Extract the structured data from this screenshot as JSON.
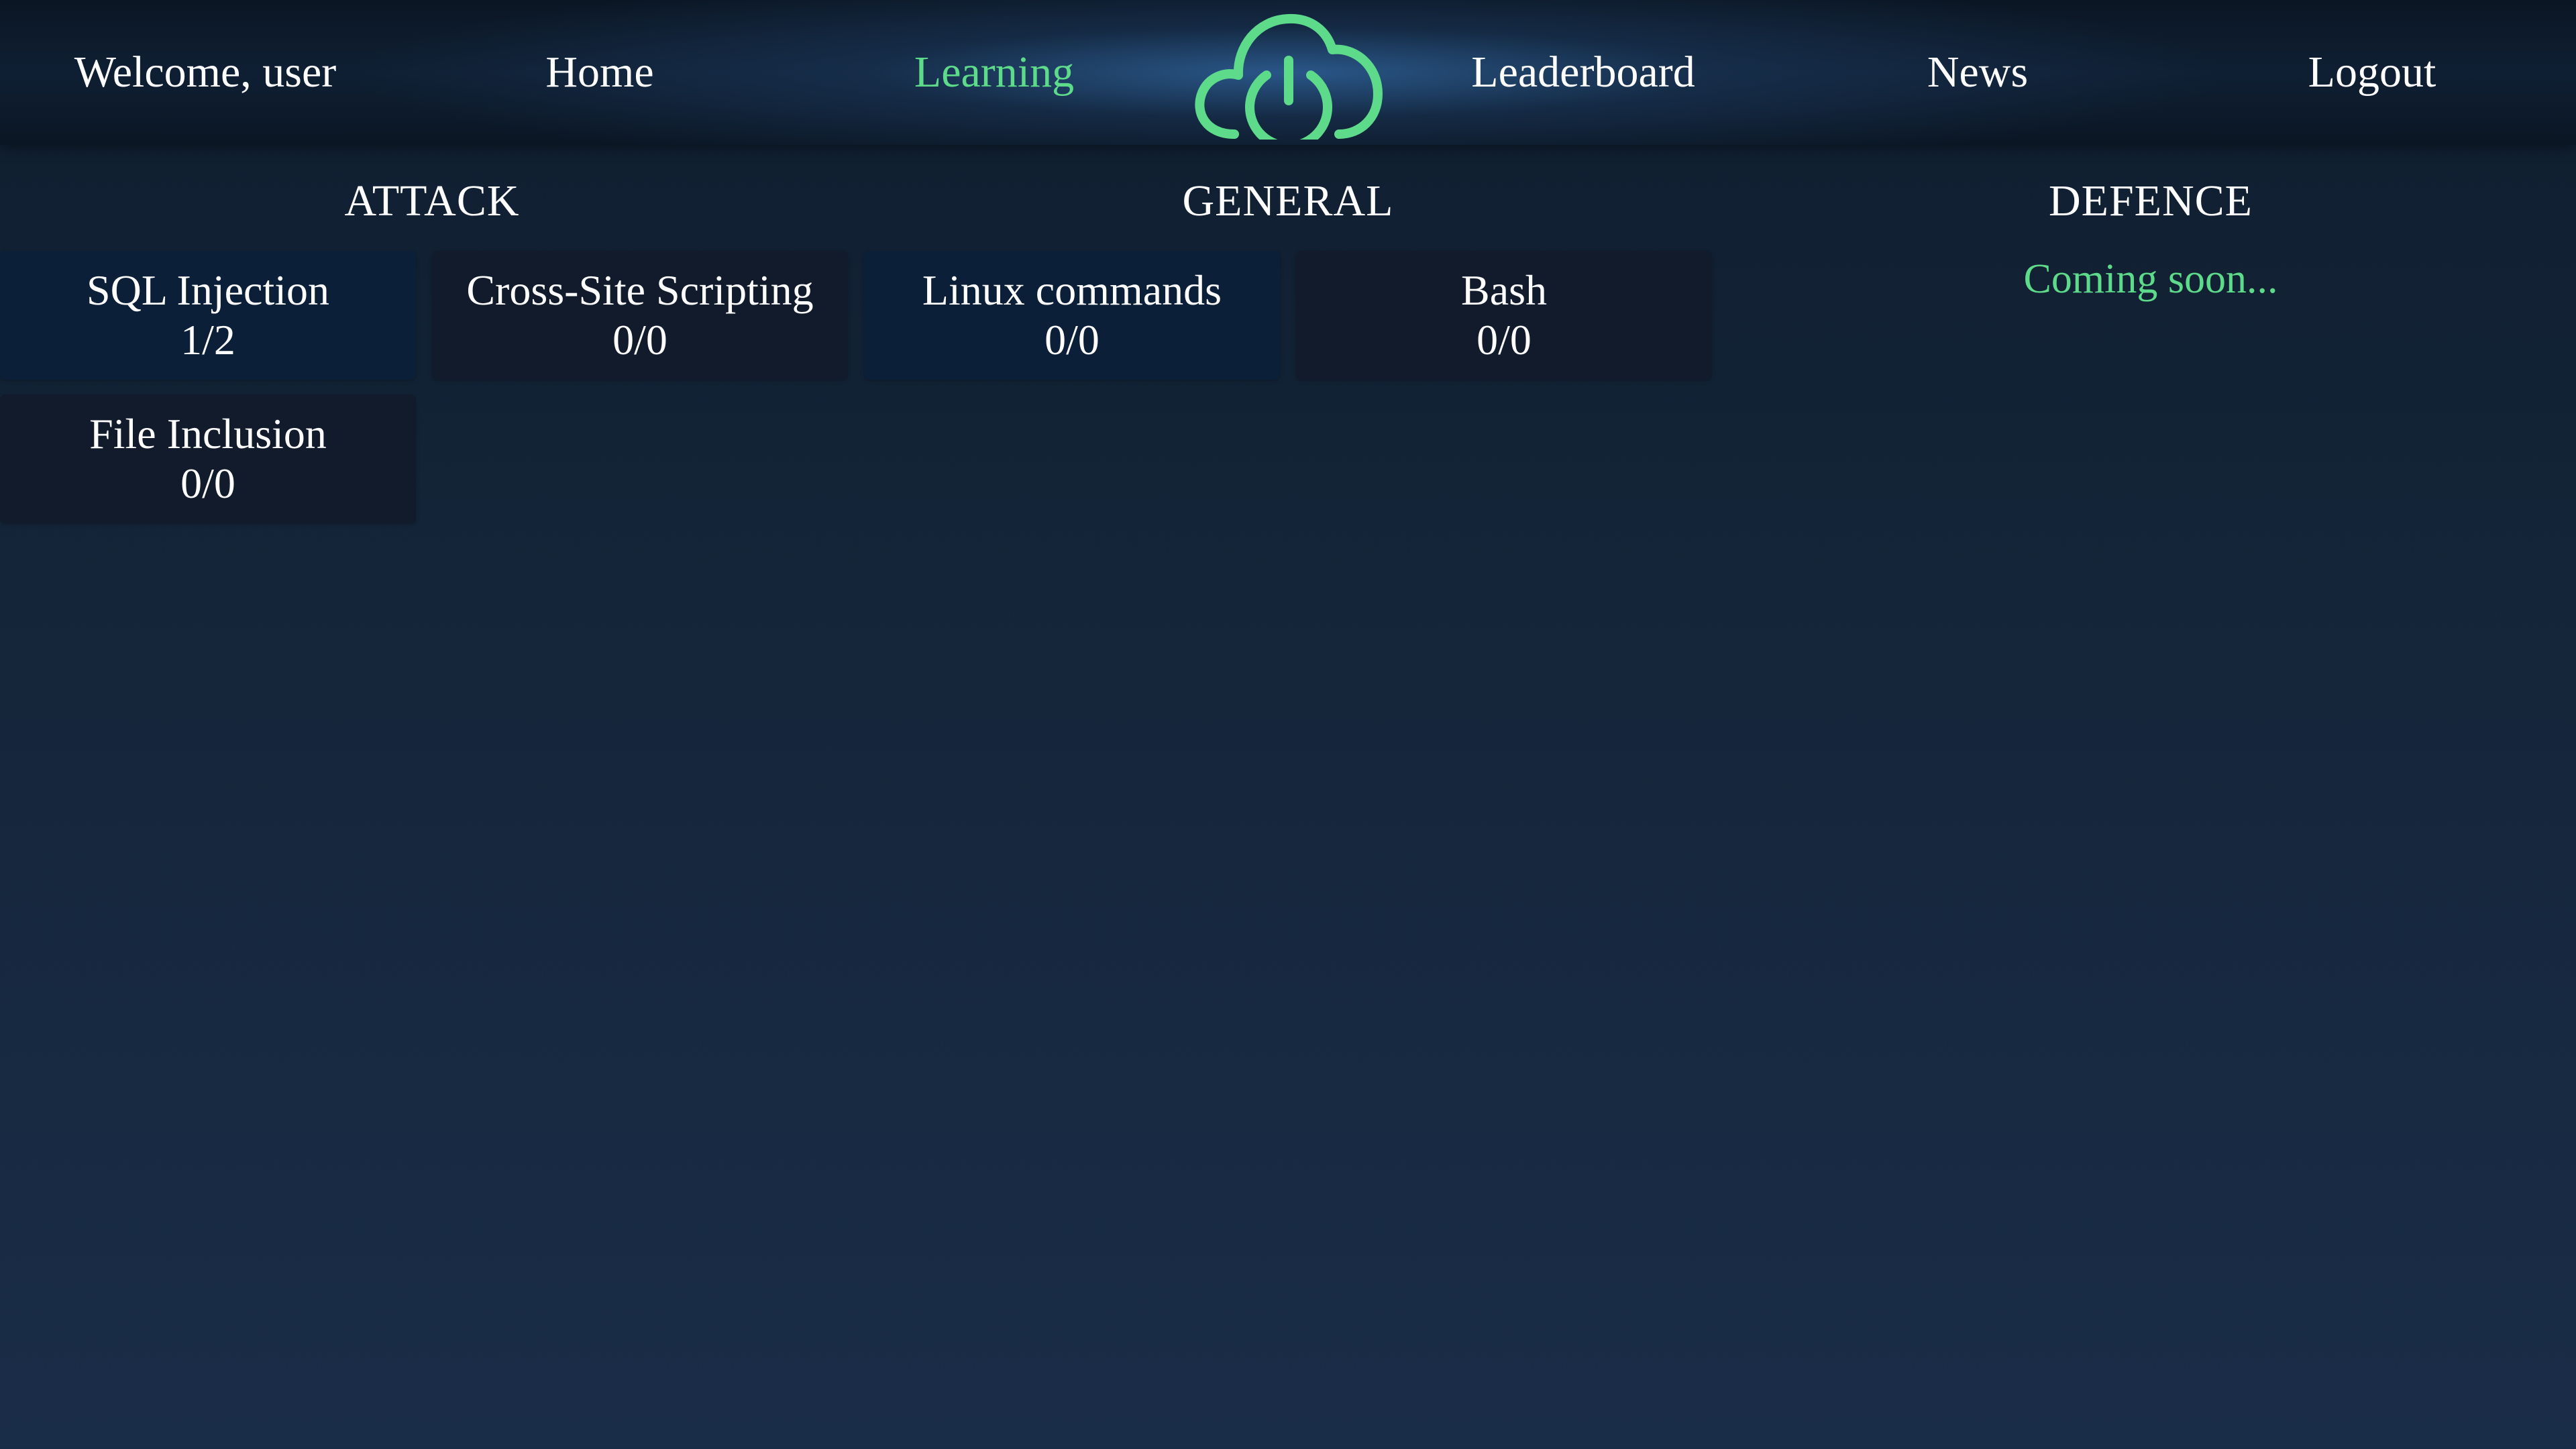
{
  "nav": {
    "welcome": "Welcome, user",
    "home": "Home",
    "learning": "Learning",
    "leaderboard": "Leaderboard",
    "news": "News",
    "logout": "Logout",
    "active": "Learning",
    "logo_icon": "cloud-power-icon"
  },
  "sections": {
    "attack": {
      "title": "ATTACK",
      "cards": [
        {
          "title": "SQL Injection",
          "score": "1/2"
        },
        {
          "title": "Cross-Site Scripting",
          "score": "0/0"
        },
        {
          "title": "File Inclusion",
          "score": "0/0"
        }
      ]
    },
    "general": {
      "title": "GENERAL",
      "cards": [
        {
          "title": "Linux commands",
          "score": "0/0"
        },
        {
          "title": "Bash",
          "score": "0/0"
        }
      ]
    },
    "defence": {
      "title": "DEFENCE",
      "status": "Coming soon..."
    }
  },
  "colors": {
    "accent": "#5ddb8a",
    "background_top": "#0f1d2e",
    "background_bottom": "#1a2d48",
    "card_highlight": "#0c1f38",
    "card_plain": "#111b2b",
    "text": "#ffffff"
  }
}
